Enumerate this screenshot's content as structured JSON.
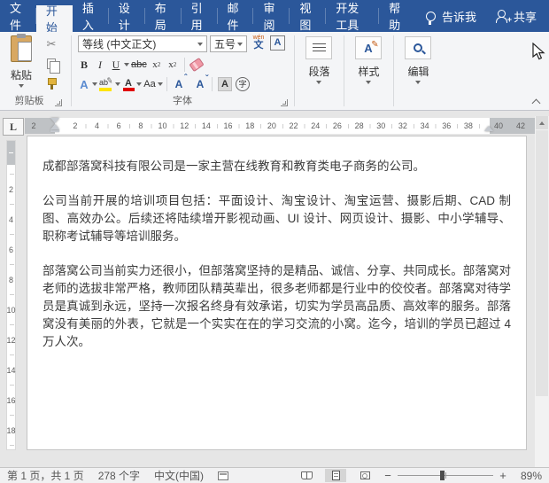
{
  "titlebar": {
    "tabs": [
      {
        "name": "file",
        "label": "文件"
      },
      {
        "name": "home",
        "label": "开始",
        "active": true
      },
      {
        "name": "insert",
        "label": "插入"
      },
      {
        "name": "design",
        "label": "设计"
      },
      {
        "name": "layout",
        "label": "布局"
      },
      {
        "name": "references",
        "label": "引用"
      },
      {
        "name": "mailings",
        "label": "邮件"
      },
      {
        "name": "review",
        "label": "审阅"
      },
      {
        "name": "view",
        "label": "视图"
      },
      {
        "name": "developer",
        "label": "开发工具"
      },
      {
        "name": "help",
        "label": "帮助"
      }
    ],
    "tell_me": "告诉我",
    "share": "共享"
  },
  "ribbon": {
    "clipboard": {
      "paste_label": "粘贴",
      "group_label": "剪贴板"
    },
    "font": {
      "font_name": "等线 (中文正文)",
      "font_size": "五号",
      "phonetic_top": "wén",
      "phonetic_bottom": "文",
      "char_border": "A",
      "bold": "B",
      "italic": "I",
      "underline": "U",
      "strikethrough": "abc",
      "subscript_base": "x",
      "subscript_mark": "2",
      "superscript_base": "x",
      "superscript_mark": "2",
      "text_effects": "A",
      "highlight": "ab",
      "highlight_pen": "✎",
      "font_color": "A",
      "change_case": "Aa",
      "grow_font": "A",
      "shrink_font": "A",
      "char_shading": "A",
      "enclose_char": "字",
      "group_label": "字体"
    },
    "paragraph_group": "段落",
    "styles_group": "样式",
    "styles_pen": "✎",
    "editing_group": "编辑"
  },
  "ruler": {
    "left_margin_label": "2",
    "h_numbers": [
      "2",
      "4",
      "6",
      "8",
      "10",
      "12",
      "14",
      "16",
      "18",
      "20",
      "22",
      "24",
      "26",
      "28",
      "30",
      "32",
      "34",
      "36",
      "38"
    ],
    "h_right": [
      "40",
      "42"
    ],
    "v_numbers": [
      "2",
      "4",
      "6",
      "8",
      "10",
      "12",
      "14",
      "16",
      "18"
    ],
    "tab_selector": "L"
  },
  "document": {
    "paragraphs": [
      "成都部落窝科技有限公司是一家主营在线教育和教育类电子商务的公司。",
      "公司当前开展的培训项目包括：平面设计、淘宝设计、淘宝运营、摄影后期、CAD 制图、高效办公。后续还将陆续增开影视动画、UI 设计、网页设计、摄影、中小学辅导、职称考试辅导等培训服务。",
      "部落窝公司当前实力还很小，但部落窝坚持的是精品、诚信、分享、共同成长。部落窝对老师的选拔非常严格，教师团队精英辈出，很多老师都是行业中的佼佼者。部落窝对待学员是真诚到永远，坚持一次报名终身有效承诺，切实为学员高品质、高效率的服务。部落窝没有美丽的外表，它就是一个实实在在的学习交流的小窝。迄今，培训的学员已超过 4 万人次。"
    ]
  },
  "statusbar": {
    "page_info": "第 1 页，共 1 页",
    "word_count": "278 个字",
    "language": "中文(中国)",
    "zoom_out": "−",
    "zoom_in": "+",
    "zoom_level": "89%"
  }
}
